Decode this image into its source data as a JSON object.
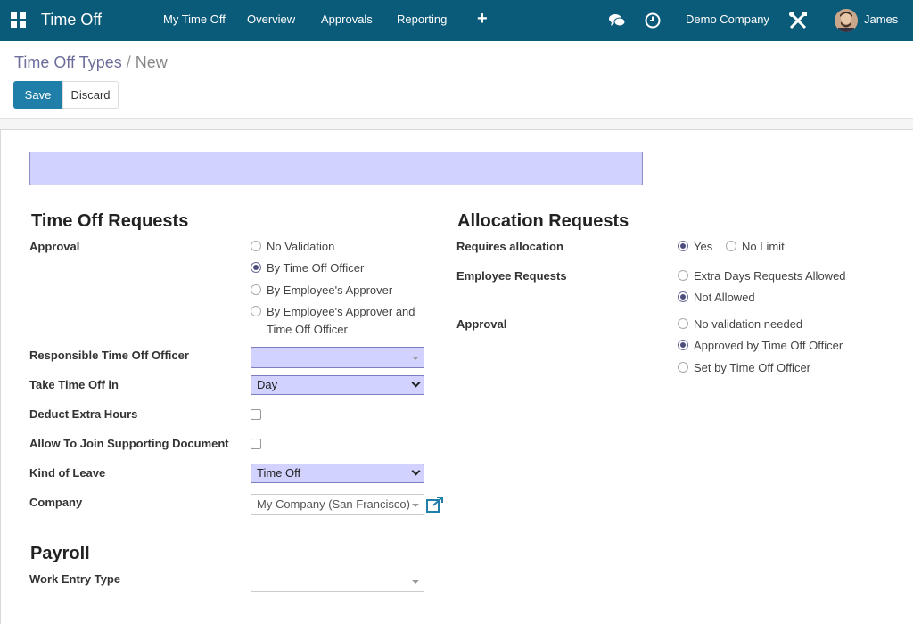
{
  "navbar": {
    "app_title": "Time Off",
    "menu": [
      "My Time Off",
      "Overview",
      "Approvals",
      "Reporting"
    ],
    "company": "Demo Company",
    "user": "James"
  },
  "breadcrumb": {
    "parent": "Time Off Types",
    "separator": "/",
    "current": "New"
  },
  "buttons": {
    "save": "Save",
    "discard": "Discard"
  },
  "form": {
    "name_value": "",
    "time_off_requests": {
      "title": "Time Off Requests",
      "approval_label": "Approval",
      "approval_options": [
        {
          "line1": "No Validation",
          "line2": "",
          "selected": false
        },
        {
          "line1": "By Time Off Officer",
          "line2": "",
          "selected": true
        },
        {
          "line1": "By Employee's Approver",
          "line2": "",
          "selected": false
        },
        {
          "line1": "By Employee's Approver and",
          "line2": "Time Off Officer",
          "selected": false
        }
      ],
      "responsible_label": "Responsible Time Off Officer",
      "responsible_value": "",
      "take_in_label": "Take Time Off in",
      "take_in_value": "Day",
      "deduct_label": "Deduct Extra Hours",
      "deduct_checked": false,
      "allow_doc_label": "Allow To Join Supporting Document",
      "allow_doc_checked": false,
      "kind_label": "Kind of Leave",
      "kind_value": "Time Off",
      "company_label": "Company",
      "company_value": "My Company (San Francisco)"
    },
    "allocation_requests": {
      "title": "Allocation Requests",
      "requires_label": "Requires allocation",
      "requires_options": [
        {
          "label": "Yes",
          "selected": true
        },
        {
          "label": "No Limit",
          "selected": false
        }
      ],
      "employee_requests_label": "Employee Requests",
      "employee_requests_options": [
        {
          "label": "Extra Days Requests Allowed",
          "selected": false
        },
        {
          "label": "Not Allowed",
          "selected": true
        }
      ],
      "approval_label": "Approval",
      "approval_options": [
        {
          "label": "No validation needed",
          "selected": false
        },
        {
          "label": "Approved by Time Off Officer",
          "selected": true
        },
        {
          "label": "Set by Time Off Officer",
          "selected": false
        }
      ]
    },
    "payroll": {
      "title": "Payroll",
      "work_entry_label": "Work Entry Type",
      "work_entry_value": ""
    }
  },
  "colors": {
    "navbar": "#0a5a79",
    "primary": "#1f7fa9",
    "required_field": "#d2d2ff"
  }
}
